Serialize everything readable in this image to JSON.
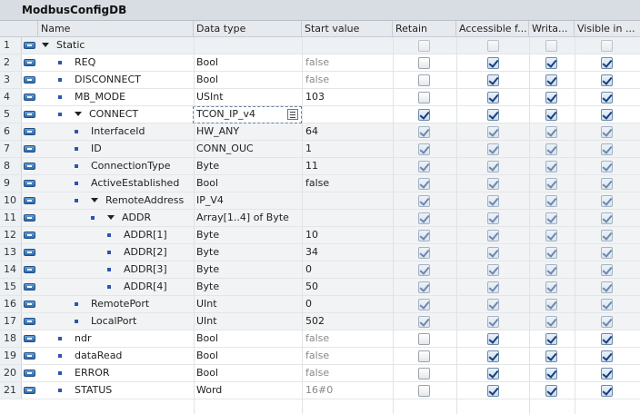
{
  "title": "ModbusConfigDB",
  "columns": {
    "name": "Name",
    "data_type": "Data type",
    "start_value": "Start value",
    "retain": "Retain",
    "accessible": "Accessible f...",
    "writable": "Writa...",
    "visible": "Visible in ..."
  },
  "rows": [
    {
      "num": "1",
      "name": "Static",
      "type": "",
      "start": "",
      "indent": 0,
      "expand": true,
      "bullet": false,
      "style": "static",
      "grey": false,
      "checks": [
        0,
        0,
        0,
        0
      ],
      "dis": true
    },
    {
      "num": "2",
      "name": "REQ",
      "type": "Bool",
      "start": "false",
      "indent": 1,
      "expand": false,
      "bullet": true,
      "style": "",
      "grey": true,
      "checks": [
        0,
        1,
        1,
        1
      ],
      "dis": false
    },
    {
      "num": "3",
      "name": "DISCONNECT",
      "type": "Bool",
      "start": "false",
      "indent": 1,
      "expand": false,
      "bullet": true,
      "style": "",
      "grey": true,
      "checks": [
        0,
        1,
        1,
        1
      ],
      "dis": false
    },
    {
      "num": "4",
      "name": "MB_MODE",
      "type": "USInt",
      "start": "103",
      "indent": 1,
      "expand": false,
      "bullet": true,
      "style": "",
      "grey": false,
      "checks": [
        0,
        1,
        1,
        1
      ],
      "dis": false
    },
    {
      "num": "5",
      "name": "CONNECT",
      "type": "TCON_IP_v4",
      "start": "",
      "indent": 1,
      "expand": true,
      "bullet": true,
      "style": "",
      "grey": false,
      "checks": [
        1,
        1,
        1,
        1
      ],
      "dis": false,
      "edit": true
    },
    {
      "num": "6",
      "name": "InterfaceId",
      "type": "HW_ANY",
      "start": "64",
      "indent": 2,
      "expand": false,
      "bullet": true,
      "style": "sub",
      "grey": false,
      "checks": [
        1,
        1,
        1,
        1
      ],
      "dis": true
    },
    {
      "num": "7",
      "name": "ID",
      "type": "CONN_OUC",
      "start": "1",
      "indent": 2,
      "expand": false,
      "bullet": true,
      "style": "sub",
      "grey": false,
      "checks": [
        1,
        1,
        1,
        1
      ],
      "dis": true
    },
    {
      "num": "8",
      "name": "ConnectionType",
      "type": "Byte",
      "start": "11",
      "indent": 2,
      "expand": false,
      "bullet": true,
      "style": "sub",
      "grey": false,
      "checks": [
        1,
        1,
        1,
        1
      ],
      "dis": true
    },
    {
      "num": "9",
      "name": "ActiveEstablished",
      "type": "Bool",
      "start": "false",
      "indent": 2,
      "expand": false,
      "bullet": true,
      "style": "sub",
      "grey": false,
      "checks": [
        1,
        1,
        1,
        1
      ],
      "dis": true
    },
    {
      "num": "10",
      "name": "RemoteAddress",
      "type": "IP_V4",
      "start": "",
      "indent": 2,
      "expand": true,
      "bullet": true,
      "style": "sub",
      "grey": false,
      "checks": [
        1,
        1,
        1,
        1
      ],
      "dis": true
    },
    {
      "num": "11",
      "name": "ADDR",
      "type": "Array[1..4] of Byte",
      "start": "",
      "indent": 3,
      "expand": true,
      "bullet": true,
      "style": "sub",
      "grey": false,
      "checks": [
        1,
        1,
        1,
        1
      ],
      "dis": true
    },
    {
      "num": "12",
      "name": "ADDR[1]",
      "type": "Byte",
      "start": "10",
      "indent": 4,
      "expand": false,
      "bullet": true,
      "style": "sub",
      "grey": false,
      "checks": [
        1,
        1,
        1,
        1
      ],
      "dis": true
    },
    {
      "num": "13",
      "name": "ADDR[2]",
      "type": "Byte",
      "start": "34",
      "indent": 4,
      "expand": false,
      "bullet": true,
      "style": "sub",
      "grey": false,
      "checks": [
        1,
        1,
        1,
        1
      ],
      "dis": true
    },
    {
      "num": "14",
      "name": "ADDR[3]",
      "type": "Byte",
      "start": "0",
      "indent": 4,
      "expand": false,
      "bullet": true,
      "style": "sub",
      "grey": false,
      "checks": [
        1,
        1,
        1,
        1
      ],
      "dis": true
    },
    {
      "num": "15",
      "name": "ADDR[4]",
      "type": "Byte",
      "start": "50",
      "indent": 4,
      "expand": false,
      "bullet": true,
      "style": "sub",
      "grey": false,
      "checks": [
        1,
        1,
        1,
        1
      ],
      "dis": true
    },
    {
      "num": "16",
      "name": "RemotePort",
      "type": "UInt",
      "start": "0",
      "indent": 2,
      "expand": false,
      "bullet": true,
      "style": "sub",
      "grey": false,
      "checks": [
        1,
        1,
        1,
        1
      ],
      "dis": true
    },
    {
      "num": "17",
      "name": "LocalPort",
      "type": "UInt",
      "start": "502",
      "indent": 2,
      "expand": false,
      "bullet": true,
      "style": "sub",
      "grey": false,
      "checks": [
        1,
        1,
        1,
        1
      ],
      "dis": true
    },
    {
      "num": "18",
      "name": "ndr",
      "type": "Bool",
      "start": "false",
      "indent": 1,
      "expand": false,
      "bullet": true,
      "style": "",
      "grey": true,
      "checks": [
        0,
        1,
        1,
        1
      ],
      "dis": false
    },
    {
      "num": "19",
      "name": "dataRead",
      "type": "Bool",
      "start": "false",
      "indent": 1,
      "expand": false,
      "bullet": true,
      "style": "",
      "grey": true,
      "checks": [
        0,
        1,
        1,
        1
      ],
      "dis": false
    },
    {
      "num": "20",
      "name": "ERROR",
      "type": "Bool",
      "start": "false",
      "indent": 1,
      "expand": false,
      "bullet": true,
      "style": "",
      "grey": true,
      "checks": [
        0,
        1,
        1,
        1
      ],
      "dis": false
    },
    {
      "num": "21",
      "name": "STATUS",
      "type": "Word",
      "start": "16#0",
      "indent": 1,
      "expand": false,
      "bullet": true,
      "style": "",
      "grey": true,
      "checks": [
        0,
        1,
        1,
        1
      ],
      "dis": false
    }
  ]
}
